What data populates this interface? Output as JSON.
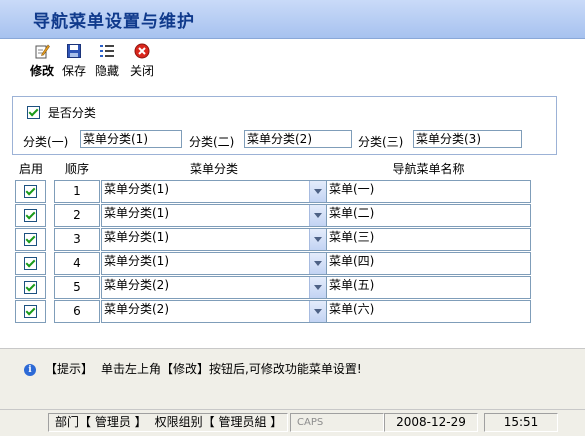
{
  "title": "导航菜单设置与维护",
  "toolbar": {
    "edit_label": "修改",
    "save_label": "保存",
    "hide_label": "隐藏",
    "close_label": "关闭"
  },
  "categorize": {
    "label": "是否分类",
    "checked": true
  },
  "categories": [
    {
      "label": "分类(一)",
      "value": "菜单分类(1)"
    },
    {
      "label": "分类(二)",
      "value": "菜单分类(2)"
    },
    {
      "label": "分类(三)",
      "value": "菜单分类(3)"
    }
  ],
  "grid": {
    "headers": {
      "enabled": "启用",
      "seq": "顺序",
      "category": "菜单分类",
      "name": "导航菜单名称"
    },
    "rows": [
      {
        "enabled": true,
        "seq": "1",
        "category": "菜单分类(1)",
        "name": "菜单(一)"
      },
      {
        "enabled": true,
        "seq": "2",
        "category": "菜单分类(1)",
        "name": "菜单(二)"
      },
      {
        "enabled": true,
        "seq": "3",
        "category": "菜单分类(1)",
        "name": "菜单(三)"
      },
      {
        "enabled": true,
        "seq": "4",
        "category": "菜单分类(1)",
        "name": "菜单(四)"
      },
      {
        "enabled": true,
        "seq": "5",
        "category": "菜单分类(2)",
        "name": "菜单(五)"
      },
      {
        "enabled": true,
        "seq": "6",
        "category": "菜单分类(2)",
        "name": "菜单(六)"
      }
    ]
  },
  "hint": {
    "tag": "【提示】",
    "text": "单击左上角【修改】按钮后,可修改功能菜单设置!"
  },
  "status": {
    "dept": "部门【 管理员 】",
    "group": "权限组别【 管理员組 】",
    "caps": "CAPS",
    "date": "2008-12-29",
    "time": "15:51"
  },
  "colors": {
    "title_bg": "#b9cff5",
    "title_text": "#103a8c",
    "check": "#1a9b1a",
    "close_icon": "#d9261c"
  }
}
